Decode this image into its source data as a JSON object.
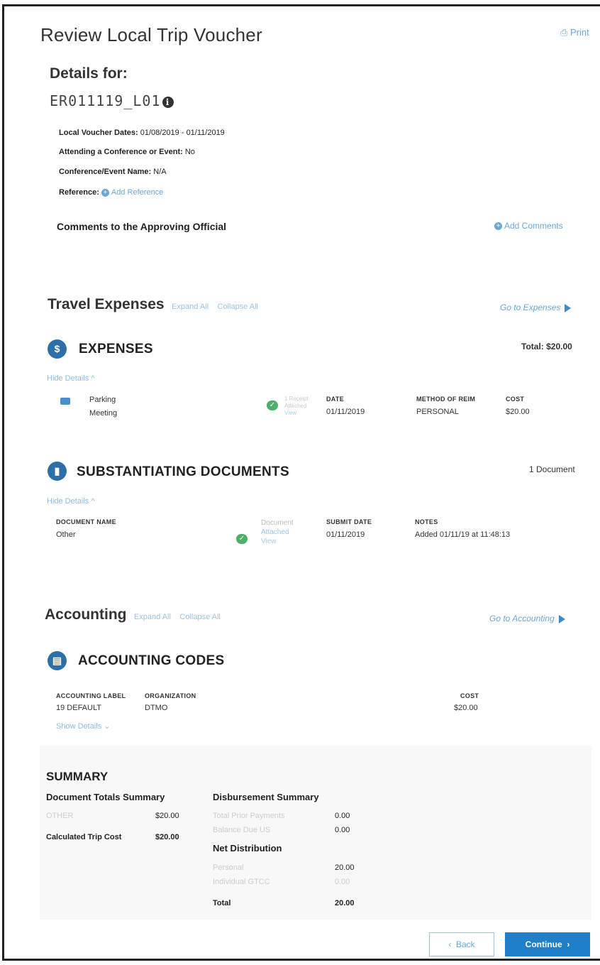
{
  "page": {
    "title": "Review Local Trip Voucher",
    "print_label": "Print",
    "details_for_label": "Details for:",
    "voucher_id": "ER011119_L01"
  },
  "meta": {
    "dates_label": "Local Voucher Dates:",
    "dates_value": "01/08/2019 - 01/11/2019",
    "conference_label": "Attending a Conference or Event:",
    "conference_value": "No",
    "event_name_label": "Conference/Event Name:",
    "event_name_value": "N/A",
    "reference_label": "Reference:",
    "add_reference": "Add Reference"
  },
  "comments": {
    "label": "Comments to the Approving Official",
    "add_label": "Add Comments"
  },
  "travel_expenses": {
    "title": "Travel Expenses",
    "expand_all": "Expand All",
    "collapse_all": "Collapse All",
    "go_to": "Go to Expenses"
  },
  "expenses": {
    "title": "EXPENSES",
    "total": "Total: $20.00",
    "hide_details": "Hide Details",
    "row": {
      "type": "Parking",
      "subtype": "Meeting",
      "receipt_line1": "1 Receipt",
      "receipt_line2": "Attached",
      "receipt_view": "View",
      "date_header": "DATE",
      "date": "01/11/2019",
      "method_header": "METHOD OF REIM",
      "method": "PERSONAL",
      "cost_header": "COST",
      "cost": "$20.00"
    }
  },
  "documents": {
    "title": "SUBSTANTIATING DOCUMENTS",
    "count": "1 Document",
    "hide_details": "Hide Details",
    "name_header": "DOCUMENT NAME",
    "name": "Other",
    "attached_line1": "Document",
    "attached_line2": "Attached",
    "attached_view": "View",
    "submit_header": "SUBMIT DATE",
    "submit_date": "01/11/2019",
    "notes_header": "NOTES",
    "notes": "Added 01/11/19 at 11:48:13"
  },
  "accounting": {
    "title": "Accounting",
    "expand_all": "Expand All",
    "collapse_all": "Collapse All",
    "go_to": "Go to Accounting",
    "codes_title": "ACCOUNTING CODES",
    "label_header": "ACCOUNTING LABEL",
    "label": "19 DEFAULT",
    "org_header": "ORGANIZATION",
    "org": "DTMO",
    "cost_header": "COST",
    "cost": "$20.00",
    "show_details": "Show Details"
  },
  "summary": {
    "title": "SUMMARY",
    "doc_totals_title": "Document Totals Summary",
    "other_label": "OTHER",
    "other_value": "$20.00",
    "calc_label": "Calculated Trip Cost",
    "calc_value": "$20.00",
    "disb_title": "Disbursement Summary",
    "total_prior_label": "Total Prior Payments",
    "total_prior_value": "0.00",
    "balance_label": "Balance Due US",
    "balance_value": "0.00",
    "net_title": "Net Distribution",
    "personal_label": "Personal",
    "personal_value": "20.00",
    "gtcc_label": "Individual GTCC",
    "gtcc_value": "0.00",
    "total_label": "Total",
    "total_value": "20.00"
  },
  "buttons": {
    "back": "Back",
    "continue": "Continue"
  }
}
